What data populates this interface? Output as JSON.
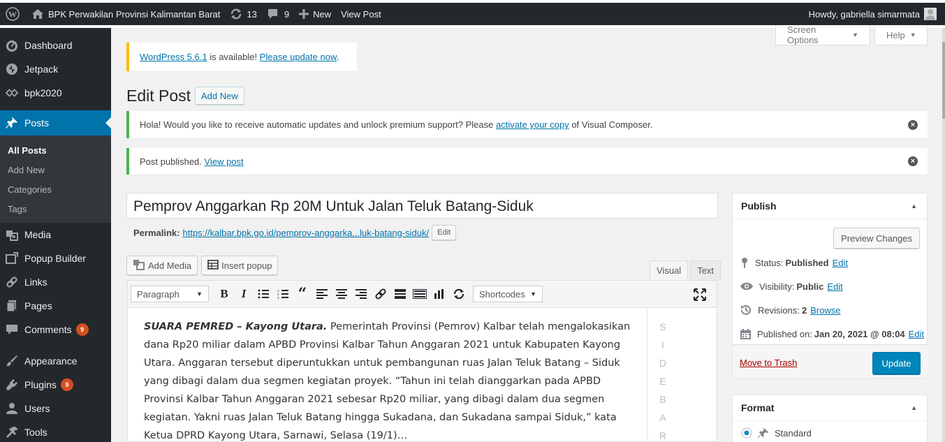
{
  "adminbar": {
    "site_name": "BPK Perwakilan Provinsi Kalimantan Barat",
    "updates_count": "13",
    "comments_count": "9",
    "new_label": "New",
    "view_post_label": "View Post",
    "howdy": "Howdy, gabriella simarmata"
  },
  "sidebar": {
    "items": [
      {
        "label": "Dashboard",
        "icon": "dashboard-icon"
      },
      {
        "label": "Jetpack",
        "icon": "jetpack-icon"
      },
      {
        "label": "bpk2020",
        "icon": "bpk2020-icon"
      },
      {
        "label": "Posts",
        "icon": "pin-icon"
      },
      {
        "label": "Media",
        "icon": "media-icon"
      },
      {
        "label": "Popup Builder",
        "icon": "popup-icon"
      },
      {
        "label": "Links",
        "icon": "link-icon"
      },
      {
        "label": "Pages",
        "icon": "pages-icon"
      },
      {
        "label": "Comments",
        "icon": "comment-icon",
        "badge": "9"
      },
      {
        "label": "Appearance",
        "icon": "brush-icon"
      },
      {
        "label": "Plugins",
        "icon": "plugin-icon",
        "badge": "9"
      },
      {
        "label": "Users",
        "icon": "user-icon"
      },
      {
        "label": "Tools",
        "icon": "tools-icon"
      }
    ],
    "posts_submenu": [
      "All Posts",
      "Add New",
      "Categories",
      "Tags"
    ]
  },
  "screen_options": "Screen Options",
  "help": "Help",
  "update_notice": {
    "link1": "WordPress 5.6.1",
    "middle": " is available! ",
    "link2": "Please update now",
    "end": "."
  },
  "page_title": "Edit Post",
  "add_new": "Add New",
  "vc_notice": {
    "before": "Hola! Would you like to receive automatic updates and unlock premium support? Please ",
    "link": "activate your copy",
    "after": " of Visual Composer."
  },
  "published_notice": {
    "text": "Post published. ",
    "link": "View post"
  },
  "post_title": "Pemprov Anggarkan Rp 20M Untuk Jalan Teluk Batang-Siduk",
  "permalink": {
    "label": "Permalink:",
    "url": "https://kalbar.bpk.go.id/pemprov-anggarka...luk-batang-siduk/",
    "edit": "Edit"
  },
  "media_buttons": {
    "add_media": "Add Media",
    "insert_popup": "Insert popup"
  },
  "editor_tabs": {
    "visual": "Visual",
    "text": "Text"
  },
  "toolbar": {
    "format": "Paragraph",
    "shortcodes": "Shortcodes"
  },
  "content": {
    "lead": "SUARA PEMRED – Kayong Utara.",
    "body": " Pemerintah Provinsi (Pemrov) Kalbar telah mengalokasikan dana Rp20 miliar dalam APBD Provinsi Kalbar Tahun Anggaran 2021 untuk Kabupaten Kayong Utara. Anggaran tersebut diperuntukkan untuk pembangunan ruas Jalan Teluk Batang – Siduk yang dibagi dalam dua segmen kegiatan proyek. “Tahun ini telah dianggarkan pada APBD Provinsi Kalbar Tahun Anggaran 2021 sebesar Rp20 miliar, yang dibagi dalam dua segmen kegiatan. Yakni  ruas Jalan Teluk Batang hingga Sukadana, dan Sukadana sampai Siduk,” kata Ketua DPRD Kayong Utara, Sarnawi, Selasa (19/1)…"
  },
  "sidebar_letters": [
    "S",
    "I",
    "D",
    "E",
    "B",
    "A",
    "R"
  ],
  "publish_box": {
    "title": "Publish",
    "preview": "Preview Changes",
    "status_label": "Status:",
    "status_value": "Published",
    "visibility_label": "Visibility:",
    "visibility_value": "Public",
    "revisions_label": "Revisions:",
    "revisions_value": "2",
    "browse": "Browse",
    "published_on_label": "Published on:",
    "published_on_value": "Jan 20, 2021 @ 08:04",
    "edit": "Edit",
    "trash": "Move to Trash",
    "update": "Update"
  },
  "format_box": {
    "title": "Format",
    "option": "Standard"
  }
}
